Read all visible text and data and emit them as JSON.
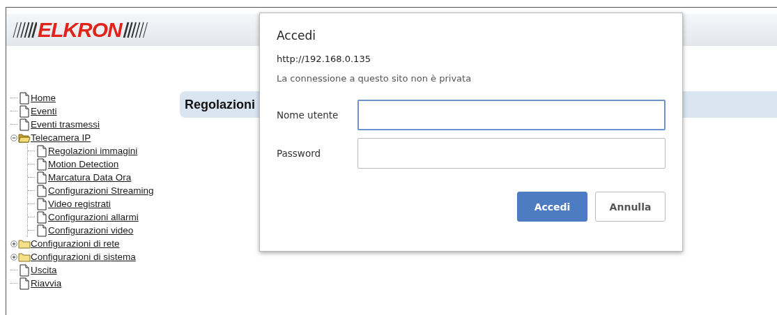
{
  "header": {
    "logo": "ELKRON"
  },
  "tree": [
    {
      "kind": "page",
      "label": "Home"
    },
    {
      "kind": "page",
      "label": "Eventi"
    },
    {
      "kind": "page",
      "label": "Eventi trasmessi"
    },
    {
      "kind": "folder",
      "label": "Telecamera IP",
      "expanded": true,
      "children": [
        {
          "kind": "page",
          "label": "Regolazioni immagini"
        },
        {
          "kind": "page",
          "label": "Motion Detection"
        },
        {
          "kind": "page",
          "label": "Marcatura Data Ora"
        },
        {
          "kind": "page",
          "label": "Configurazioni Streaming"
        },
        {
          "kind": "page",
          "label": "Video registrati"
        },
        {
          "kind": "page",
          "label": "Configurazioni allarmi"
        },
        {
          "kind": "page",
          "label": "Configurazioni video"
        }
      ]
    },
    {
      "kind": "folder",
      "label": "Configurazioni di rete",
      "expanded": false
    },
    {
      "kind": "folder",
      "label": "Configurazioni di sistema",
      "expanded": false
    },
    {
      "kind": "page",
      "label": "Uscita"
    },
    {
      "kind": "page",
      "label": "Riavvia"
    }
  ],
  "content": {
    "heading": "Regolazioni"
  },
  "dialog": {
    "title": "Accedi",
    "url": "http://192.168.0.135",
    "notice": "La connessione a questo sito non è privata",
    "fields": [
      {
        "label": "Nome utente",
        "focused": true
      },
      {
        "label": "Password",
        "focused": false
      }
    ],
    "buttons": [
      {
        "label": "Accedi",
        "kind": "primary"
      },
      {
        "label": "Annulla",
        "kind": "secondary"
      }
    ]
  }
}
